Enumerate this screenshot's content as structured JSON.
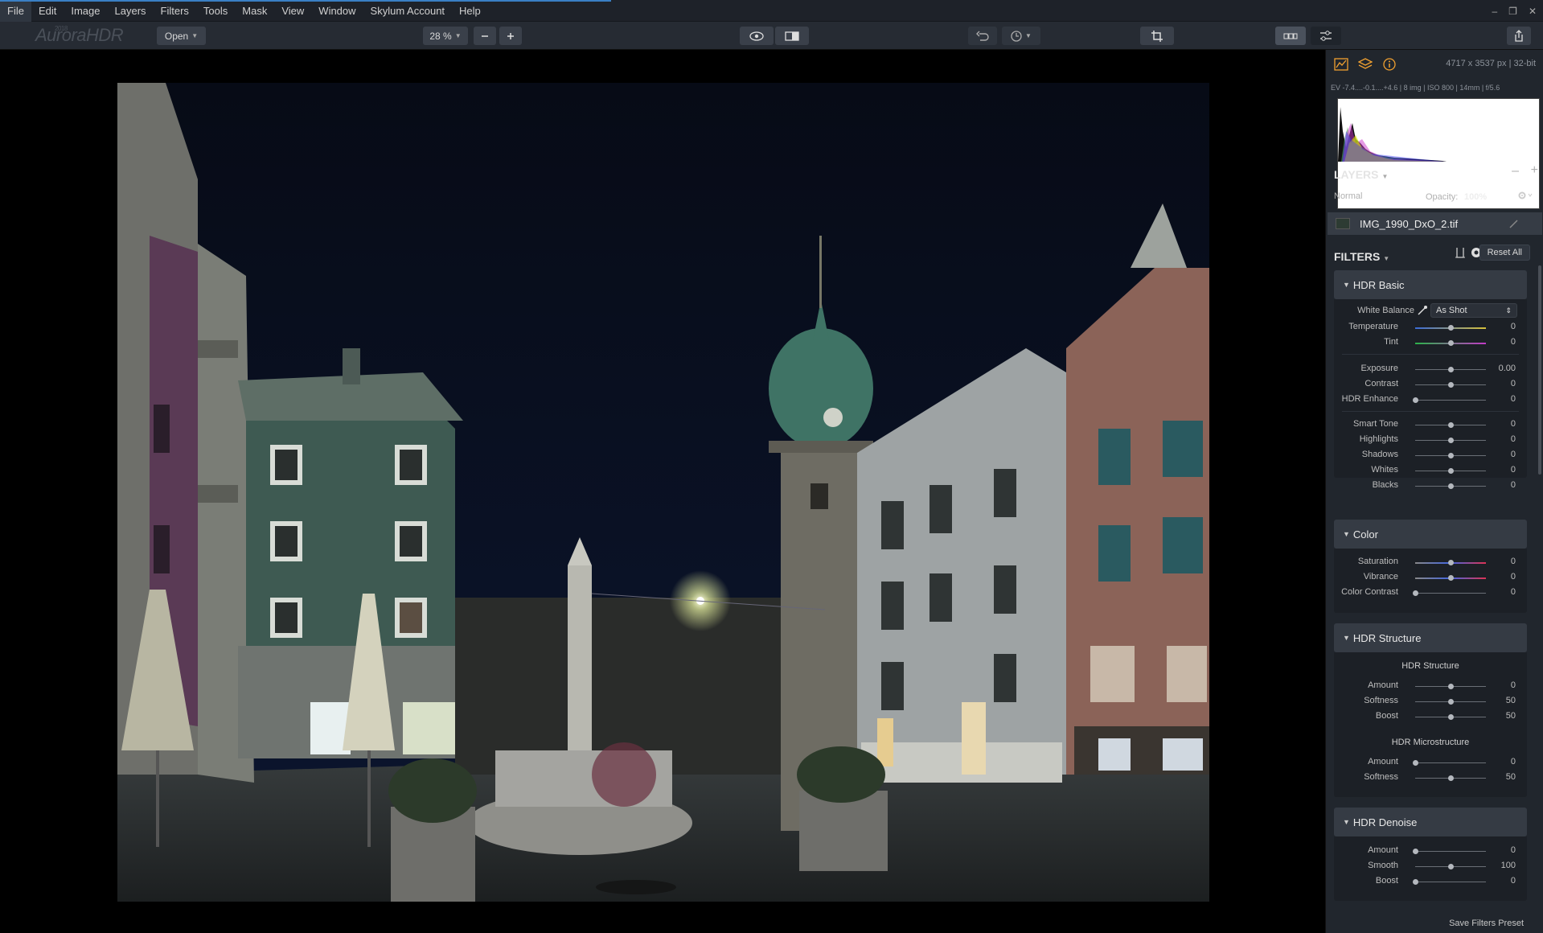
{
  "menu": [
    "File",
    "Edit",
    "Image",
    "Layers",
    "Filters",
    "Tools",
    "Mask",
    "View",
    "Window",
    "Skylum Account",
    "Help"
  ],
  "window_controls": [
    "–",
    "❐",
    "✕"
  ],
  "toolbar": {
    "logo": "AuroraHDR",
    "logo_sup": "2018",
    "open_label": "Open",
    "zoom_value": "28 %"
  },
  "image_info": {
    "dimensions": "4717 x 3537 px  |  32-bit",
    "exposure_meta": "EV -7.4....-0.1....+4.6  |   8 img   |  ISO 800  |  14mm  |   f/5.6"
  },
  "layers": {
    "title": "LAYERS",
    "blend_mode": "Normal",
    "opacity_label": "Opacity:",
    "opacity_value": "100%",
    "layer_name": "IMG_1990_DxO_2.tif"
  },
  "filters": {
    "title": "FILTERS",
    "reset_label": "Reset All",
    "save_preset": "Save Filters Preset",
    "hdr_basic": {
      "title": "HDR Basic",
      "white_balance_label": "White Balance",
      "white_balance_value": "As Shot",
      "temperature": {
        "label": "Temperature",
        "value": "0",
        "pos": 0.5
      },
      "tint": {
        "label": "Tint",
        "value": "0",
        "pos": 0.5
      },
      "exposure": {
        "label": "Exposure",
        "value": "0.00",
        "pos": 0.5
      },
      "contrast": {
        "label": "Contrast",
        "value": "0",
        "pos": 0.5
      },
      "hdr_enhance": {
        "label": "HDR Enhance",
        "value": "0",
        "pos": 0
      },
      "smart_tone": {
        "label": "Smart Tone",
        "value": "0",
        "pos": 0.5
      },
      "highlights": {
        "label": "Highlights",
        "value": "0",
        "pos": 0.5
      },
      "shadows": {
        "label": "Shadows",
        "value": "0",
        "pos": 0.5
      },
      "whites": {
        "label": "Whites",
        "value": "0",
        "pos": 0.5
      },
      "blacks": {
        "label": "Blacks",
        "value": "0",
        "pos": 0.5
      }
    },
    "color": {
      "title": "Color",
      "saturation": {
        "label": "Saturation",
        "value": "0",
        "pos": 0.5
      },
      "vibrance": {
        "label": "Vibrance",
        "value": "0",
        "pos": 0.5
      },
      "color_contrast": {
        "label": "Color Contrast",
        "value": "0",
        "pos": 0
      }
    },
    "hdr_structure": {
      "title": "HDR Structure",
      "sub1": "HDR Structure",
      "amount": {
        "label": "Amount",
        "value": "0",
        "pos": 0.5
      },
      "softness": {
        "label": "Softness",
        "value": "50",
        "pos": 0.5
      },
      "boost": {
        "label": "Boost",
        "value": "50",
        "pos": 0.5
      },
      "sub2": "HDR Microstructure",
      "m_amount": {
        "label": "Amount",
        "value": "0",
        "pos": 0
      },
      "m_softness": {
        "label": "Softness",
        "value": "50",
        "pos": 0.5
      }
    },
    "hdr_denoise": {
      "title": "HDR Denoise",
      "amount": {
        "label": "Amount",
        "value": "0",
        "pos": 0
      },
      "smooth": {
        "label": "Smooth",
        "value": "100",
        "pos": 0.5
      },
      "boost": {
        "label": "Boost",
        "value": "0",
        "pos": 0
      }
    }
  }
}
